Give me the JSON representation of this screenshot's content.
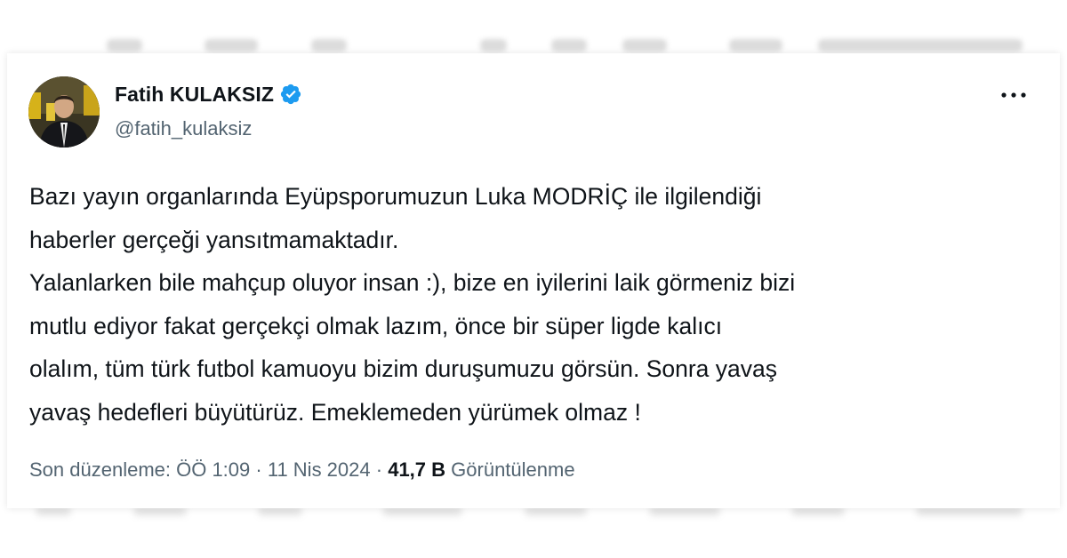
{
  "tweet": {
    "author": {
      "display_name": "Fatih KULAKSIZ",
      "handle": "@fatih_kulaksiz",
      "verified": true
    },
    "text_lines": [
      "Bazı yayın organlarında Eyüpsporumuzun Luka MODRİÇ ile ilgilendiği",
      "haberler gerçeği yansıtmamaktadır.",
      "Yalanlarken bile mahçup oluyor insan :), bize en iyilerini laik görmeniz bizi",
      "mutlu ediyor fakat gerçekçi olmak lazım, önce bir süper ligde kalıcı",
      "olalım, tüm türk futbol kamuoyu bizim duruşumuzu görsün. Sonra yavaş",
      "yavaş hedefleri büyütürüz. Emeklemeden yürümek olmaz !"
    ],
    "meta": {
      "edited_label": "Son düzenleme: ÖÖ 1:09",
      "separator": "·",
      "date": "11 Nis 2024",
      "views_count": "41,7 B",
      "views_label": "Görüntülenme"
    }
  },
  "icons": {
    "verified": "verified-badge-icon",
    "more": "more-horizontal-icon"
  },
  "colors": {
    "text_primary": "#0f1419",
    "text_secondary": "#536471",
    "verified_blue": "#1d9bf0",
    "background": "#ffffff"
  }
}
